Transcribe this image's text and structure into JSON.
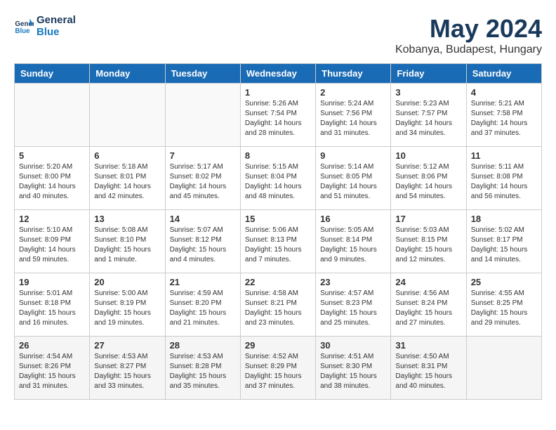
{
  "logo": {
    "line1": "General",
    "line2": "Blue"
  },
  "title": "May 2024",
  "subtitle": "Kobanya, Budapest, Hungary",
  "weekdays": [
    "Sunday",
    "Monday",
    "Tuesday",
    "Wednesday",
    "Thursday",
    "Friday",
    "Saturday"
  ],
  "weeks": [
    [
      {
        "day": "",
        "info": ""
      },
      {
        "day": "",
        "info": ""
      },
      {
        "day": "",
        "info": ""
      },
      {
        "day": "1",
        "info": "Sunrise: 5:26 AM\nSunset: 7:54 PM\nDaylight: 14 hours\nand 28 minutes."
      },
      {
        "day": "2",
        "info": "Sunrise: 5:24 AM\nSunset: 7:56 PM\nDaylight: 14 hours\nand 31 minutes."
      },
      {
        "day": "3",
        "info": "Sunrise: 5:23 AM\nSunset: 7:57 PM\nDaylight: 14 hours\nand 34 minutes."
      },
      {
        "day": "4",
        "info": "Sunrise: 5:21 AM\nSunset: 7:58 PM\nDaylight: 14 hours\nand 37 minutes."
      }
    ],
    [
      {
        "day": "5",
        "info": "Sunrise: 5:20 AM\nSunset: 8:00 PM\nDaylight: 14 hours\nand 40 minutes."
      },
      {
        "day": "6",
        "info": "Sunrise: 5:18 AM\nSunset: 8:01 PM\nDaylight: 14 hours\nand 42 minutes."
      },
      {
        "day": "7",
        "info": "Sunrise: 5:17 AM\nSunset: 8:02 PM\nDaylight: 14 hours\nand 45 minutes."
      },
      {
        "day": "8",
        "info": "Sunrise: 5:15 AM\nSunset: 8:04 PM\nDaylight: 14 hours\nand 48 minutes."
      },
      {
        "day": "9",
        "info": "Sunrise: 5:14 AM\nSunset: 8:05 PM\nDaylight: 14 hours\nand 51 minutes."
      },
      {
        "day": "10",
        "info": "Sunrise: 5:12 AM\nSunset: 8:06 PM\nDaylight: 14 hours\nand 54 minutes."
      },
      {
        "day": "11",
        "info": "Sunrise: 5:11 AM\nSunset: 8:08 PM\nDaylight: 14 hours\nand 56 minutes."
      }
    ],
    [
      {
        "day": "12",
        "info": "Sunrise: 5:10 AM\nSunset: 8:09 PM\nDaylight: 14 hours\nand 59 minutes."
      },
      {
        "day": "13",
        "info": "Sunrise: 5:08 AM\nSunset: 8:10 PM\nDaylight: 15 hours\nand 1 minute."
      },
      {
        "day": "14",
        "info": "Sunrise: 5:07 AM\nSunset: 8:12 PM\nDaylight: 15 hours\nand 4 minutes."
      },
      {
        "day": "15",
        "info": "Sunrise: 5:06 AM\nSunset: 8:13 PM\nDaylight: 15 hours\nand 7 minutes."
      },
      {
        "day": "16",
        "info": "Sunrise: 5:05 AM\nSunset: 8:14 PM\nDaylight: 15 hours\nand 9 minutes."
      },
      {
        "day": "17",
        "info": "Sunrise: 5:03 AM\nSunset: 8:15 PM\nDaylight: 15 hours\nand 12 minutes."
      },
      {
        "day": "18",
        "info": "Sunrise: 5:02 AM\nSunset: 8:17 PM\nDaylight: 15 hours\nand 14 minutes."
      }
    ],
    [
      {
        "day": "19",
        "info": "Sunrise: 5:01 AM\nSunset: 8:18 PM\nDaylight: 15 hours\nand 16 minutes."
      },
      {
        "day": "20",
        "info": "Sunrise: 5:00 AM\nSunset: 8:19 PM\nDaylight: 15 hours\nand 19 minutes."
      },
      {
        "day": "21",
        "info": "Sunrise: 4:59 AM\nSunset: 8:20 PM\nDaylight: 15 hours\nand 21 minutes."
      },
      {
        "day": "22",
        "info": "Sunrise: 4:58 AM\nSunset: 8:21 PM\nDaylight: 15 hours\nand 23 minutes."
      },
      {
        "day": "23",
        "info": "Sunrise: 4:57 AM\nSunset: 8:23 PM\nDaylight: 15 hours\nand 25 minutes."
      },
      {
        "day": "24",
        "info": "Sunrise: 4:56 AM\nSunset: 8:24 PM\nDaylight: 15 hours\nand 27 minutes."
      },
      {
        "day": "25",
        "info": "Sunrise: 4:55 AM\nSunset: 8:25 PM\nDaylight: 15 hours\nand 29 minutes."
      }
    ],
    [
      {
        "day": "26",
        "info": "Sunrise: 4:54 AM\nSunset: 8:26 PM\nDaylight: 15 hours\nand 31 minutes."
      },
      {
        "day": "27",
        "info": "Sunrise: 4:53 AM\nSunset: 8:27 PM\nDaylight: 15 hours\nand 33 minutes."
      },
      {
        "day": "28",
        "info": "Sunrise: 4:53 AM\nSunset: 8:28 PM\nDaylight: 15 hours\nand 35 minutes."
      },
      {
        "day": "29",
        "info": "Sunrise: 4:52 AM\nSunset: 8:29 PM\nDaylight: 15 hours\nand 37 minutes."
      },
      {
        "day": "30",
        "info": "Sunrise: 4:51 AM\nSunset: 8:30 PM\nDaylight: 15 hours\nand 38 minutes."
      },
      {
        "day": "31",
        "info": "Sunrise: 4:50 AM\nSunset: 8:31 PM\nDaylight: 15 hours\nand 40 minutes."
      },
      {
        "day": "",
        "info": ""
      }
    ]
  ]
}
